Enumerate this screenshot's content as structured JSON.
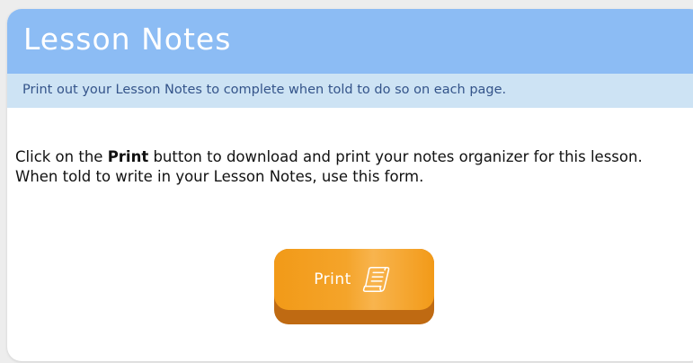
{
  "header": {
    "title": "Lesson Notes",
    "subtitle": "Print out your Lesson Notes to complete when told to do so on each page."
  },
  "body": {
    "text_before": "Click on the ",
    "text_bold": "Print",
    "text_after": " button to download and print your notes organizer for this lesson. When told to write in your Lesson Notes, use this form."
  },
  "print_button": {
    "label": "Print",
    "icon": "scroll-icon"
  },
  "colors": {
    "header_bg": "#8cbcf4",
    "subheader_bg": "#cde3f4",
    "button_orange": "#f29a18",
    "button_shadow": "#bf6a12"
  }
}
